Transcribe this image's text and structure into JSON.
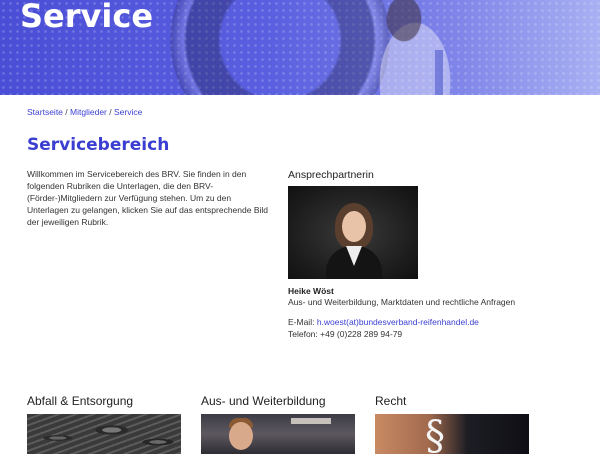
{
  "hero": {
    "title": "Service"
  },
  "breadcrumb": [
    {
      "label": "Startseite"
    },
    {
      "label": "Mitglieder"
    },
    {
      "label": "Service"
    }
  ],
  "breadcrumb_separator": "/",
  "main": {
    "title": "Servicebereich",
    "intro": "Willkommen im Servicebereich des BRV. Sie finden in den folgenden Rubriken die Unterlagen, die den BRV-(Förder-)Mitgliedern zur Verfügung stehen. Um zu den Unterlagen zu gelangen, klicken Sie auf das entsprechende Bild der jeweiligen Rubrik."
  },
  "contact": {
    "heading": "Ansprechpartnerin",
    "name": "Heike Wöst",
    "role": "Aus- und Weiterbildung, Marktdaten und rechtliche Anfragen",
    "email_label": "E-Mail:",
    "email": "h.woest(at)bundesverband-reifenhandel.de",
    "phone_label": "Telefon:",
    "phone": "+49 (0)228 289 94-79"
  },
  "categories": [
    {
      "title": "Abfall & Entsorgung"
    },
    {
      "title": "Aus- und Weiterbildung"
    },
    {
      "title": "Recht",
      "symbol": "§"
    }
  ]
}
